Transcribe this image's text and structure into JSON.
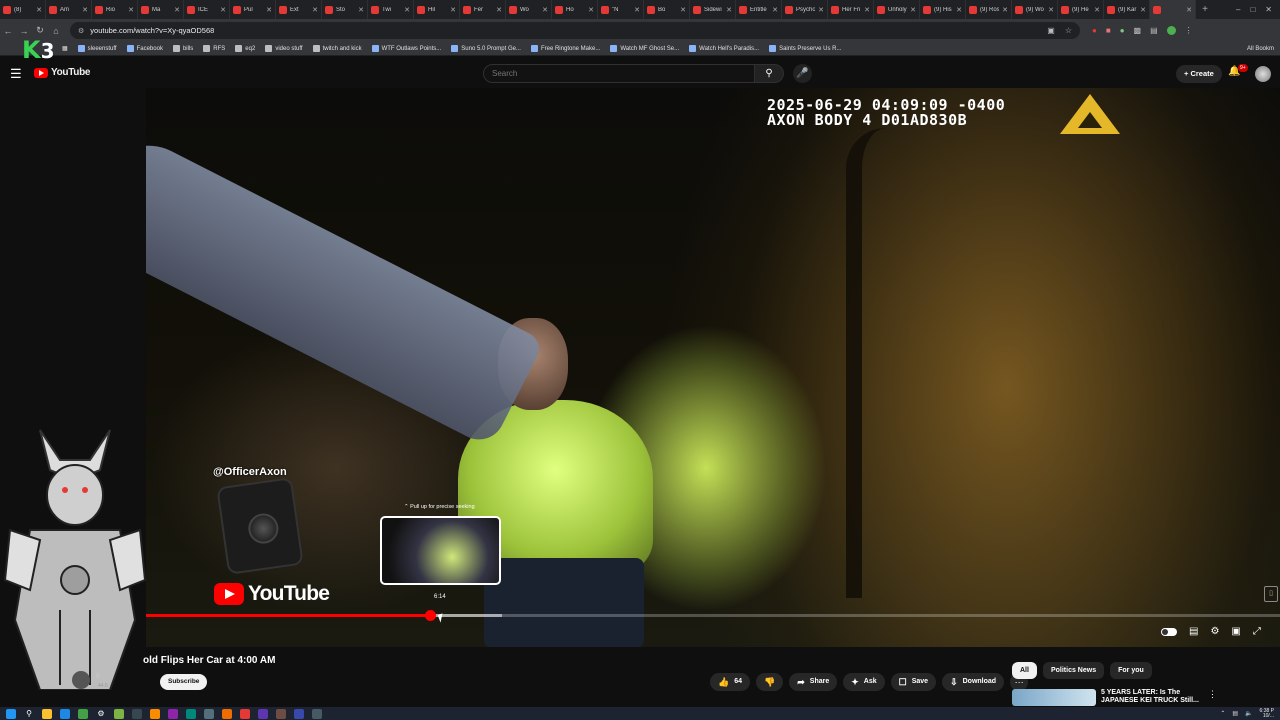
{
  "browser": {
    "tabs": [
      {
        "label": "(8)",
        "color": "#e53935"
      },
      {
        "label": "Am",
        "color": "#e53935"
      },
      {
        "label": "Rio",
        "color": "#e53935"
      },
      {
        "label": "Ma",
        "color": "#e53935"
      },
      {
        "label": "ICE",
        "color": "#e53935"
      },
      {
        "label": "Pul",
        "color": "#e53935"
      },
      {
        "label": "Ext",
        "color": "#e53935"
      },
      {
        "label": "Sto",
        "color": "#e53935"
      },
      {
        "label": "Twi",
        "color": "#e53935"
      },
      {
        "label": "Hil",
        "color": "#e53935"
      },
      {
        "label": "Fer",
        "color": "#e53935"
      },
      {
        "label": "Wo",
        "color": "#e53935"
      },
      {
        "label": "Ho",
        "color": "#e53935"
      },
      {
        "label": "\"N",
        "color": "#e53935"
      },
      {
        "label": "Bo",
        "color": "#e53935"
      },
      {
        "label": "Sidewi",
        "color": "#e53935"
      },
      {
        "label": "Entitle",
        "color": "#e53935"
      },
      {
        "label": "Psycho",
        "color": "#e53935"
      },
      {
        "label": "Her Fri",
        "color": "#e53935"
      },
      {
        "label": "Unholy",
        "color": "#e53935"
      },
      {
        "label": "(9) His",
        "color": "#e53935"
      },
      {
        "label": "(9) Ros",
        "color": "#e53935"
      },
      {
        "label": "(9) Wo",
        "color": "#e53935"
      },
      {
        "label": "(9) He",
        "color": "#e53935"
      },
      {
        "label": "(9) Kar",
        "color": "#e53935"
      },
      {
        "label": "",
        "color": "#e53935",
        "active": true
      }
    ],
    "new_tab": "+",
    "url": "youtube.com/watch?v=Xy-qyaOD568",
    "bookmarks": [
      {
        "label": "sleeenstuff",
        "icon": "bookmark-icon"
      },
      {
        "label": "Facebook",
        "icon": "facebook-icon"
      },
      {
        "label": "bills",
        "icon": "folder-icon"
      },
      {
        "label": "RFS",
        "icon": "folder-icon"
      },
      {
        "label": "eq2",
        "icon": "folder-icon"
      },
      {
        "label": "video stuff",
        "icon": "folder-icon"
      },
      {
        "label": "twitch and kick",
        "icon": "folder-icon"
      },
      {
        "label": "WTF Outlaws Points...",
        "icon": "bookmark-icon"
      },
      {
        "label": "Suno 5.0 Prompt Ge...",
        "icon": "bookmark-icon"
      },
      {
        "label": "Free Ringtone Make...",
        "icon": "bookmark-icon"
      },
      {
        "label": "Watch MF Ghost Se...",
        "icon": "bookmark-icon"
      },
      {
        "label": "Watch Hell's Paradis...",
        "icon": "bookmark-icon"
      },
      {
        "label": "Saints Preserve Us R...",
        "icon": "bookmark-icon"
      }
    ],
    "all_bookmarks": "All Bookm"
  },
  "overlay": {
    "k": "K",
    "n": "3"
  },
  "youtube": {
    "logo": "YouTube",
    "search_placeholder": "Search",
    "create_label": "Create",
    "notif_badge": "9+"
  },
  "video": {
    "timestamp_line1": "2025-06-29 04:09:09 -0400",
    "timestamp_line2": "AXON BODY 4 D01AD830B",
    "officer_handle": "@OfficerAxon",
    "watermark": "YouTube",
    "seek_hint": "Pull up for precise seeking",
    "seek_time": "6:14",
    "progress_played_fraction": 0.25
  },
  "below": {
    "title": "old Flips Her Car at 4:00 AM",
    "channel_subs_line1": "0",
    "channel_subs_line2": "44.6",
    "subscribe_label": "Subscribe",
    "like_count": "64",
    "share_label": "Share",
    "ask_label": "Ask",
    "save_label": "Save",
    "download_label": "Download",
    "chips": [
      "All",
      "Politics News",
      "For you"
    ],
    "rec_title": "5 YEARS LATER: Is The JAPANESE KEI TRUCK Still..."
  },
  "taskbar": {
    "time": "6:38 P",
    "date": "10/..."
  }
}
